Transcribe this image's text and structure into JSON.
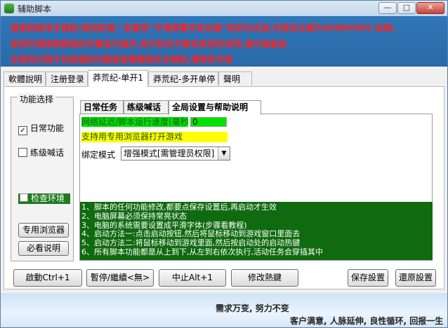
{
  "window": {
    "title": "辅助脚本",
    "min": "—",
    "max": "□",
    "close": "✕"
  },
  "notice": {
    "line1": "感谢您使用本辅助:使用前请一定要将”平滑屏幕字体边缘”前的勾去掉,并修改主题为WINDOWS 经典;",
    "line2": "使用时请按照教程的步骤进行操作,单开和多开都有具体的说明,请仔细查阅",
    "line3": "在使用过程中如果遇到问题或者需要购买本辅助,请联系作者"
  },
  "tabs": [
    "軟體說明",
    "注册登录",
    "莽荒纪-单开1",
    "莽荒纪-多开单停",
    "聲明"
  ],
  "active_tab": "莽荒纪-单开1",
  "function_group": {
    "title": "功能选择",
    "daily": {
      "label": "日常功能",
      "checked": true
    },
    "shout": {
      "label": "练级喊话",
      "checked": false
    },
    "check_env": {
      "label": "检查环境",
      "checked": false
    },
    "browser_btn": "专用浏览器",
    "readme_btn": "必看说明"
  },
  "subtabs": [
    "日常任务",
    "练级喊话",
    "全局设置与帮助说明"
  ],
  "active_subtab": "全局设置与帮助说明",
  "settings": {
    "latency_label": "网络延迟/脚本运行速度(毫秒)",
    "latency_value": "0",
    "browser_label": "支持用专用浏览器打开游戏",
    "bind_label": "绑定模式",
    "bind_value": "增强模式[需管理员权限]"
  },
  "help_lines": [
    "1、脚本的任何功能修改,都要点保存设置后,再启动才生效",
    "2、电脑屏幕必须保持常亮状态",
    "3、电脑的系统需要设置成平滑字体(步骤看教程)",
    "4、启动方法一:点击启动按钮,然后将鼠标移动到游戏窗口里面去",
    "5、启动方法二:将鼠标移动到游戏里面,然后按启动处的启动热键",
    "6、所有脚本功能都是从上到下,从左到右依次执行,活动任务会穿插其中"
  ],
  "buttons": {
    "start": "啟動Ctrl+1",
    "pause": "暫停/繼續<無>",
    "stop": "中止Alt+1",
    "hotkey": "修改熱鍵",
    "save": "保存設置",
    "restore": "還原設置"
  },
  "footer": {
    "line1": "需求万变, 努力不变",
    "line2": "客户满意, 人脉延伸, 良性循环, 回报一生"
  }
}
